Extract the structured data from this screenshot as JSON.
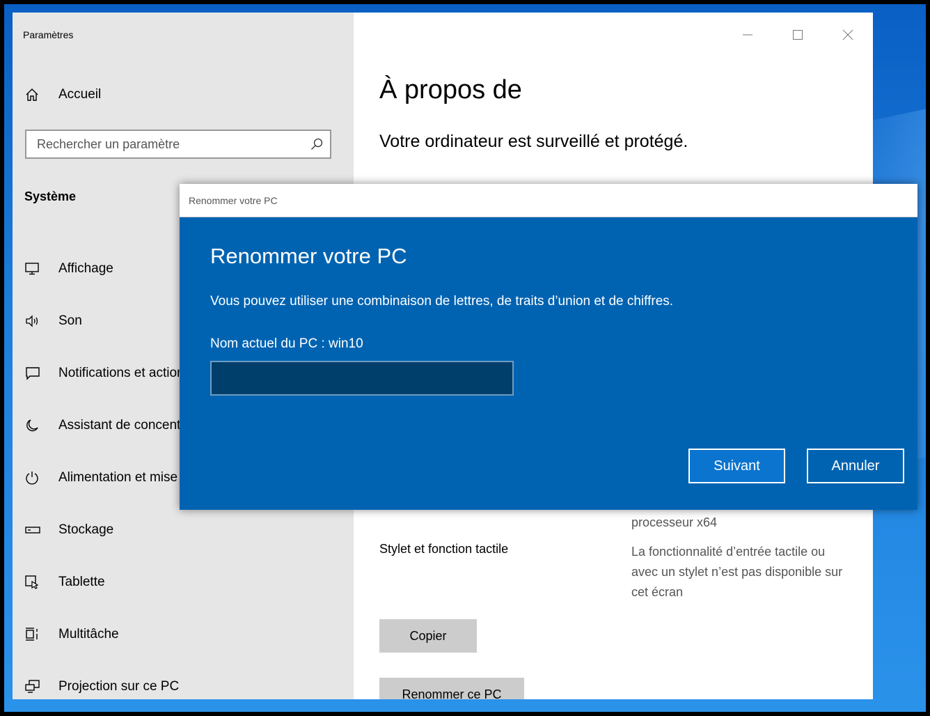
{
  "window": {
    "title": "Paramètres"
  },
  "sidebar": {
    "home_label": "Accueil",
    "search_placeholder": "Rechercher un paramètre",
    "section_title": "Système",
    "items": [
      {
        "label": "Affichage",
        "icon": "monitor-icon"
      },
      {
        "label": "Son",
        "icon": "speaker-icon"
      },
      {
        "label": "Notifications et actions",
        "icon": "notification-icon"
      },
      {
        "label": "Assistant de concentration",
        "icon": "moon-icon"
      },
      {
        "label": "Alimentation et mise en veille",
        "icon": "power-icon"
      },
      {
        "label": "Stockage",
        "icon": "storage-icon"
      },
      {
        "label": "Tablette",
        "icon": "tablet-icon"
      },
      {
        "label": "Multitâche",
        "icon": "multitask-icon"
      },
      {
        "label": "Projection sur ce PC",
        "icon": "projection-icon"
      }
    ]
  },
  "main": {
    "title": "À propos de",
    "status": "Votre ordinateur est surveillé et protégé.",
    "processor_text": "processeur x64",
    "pen_touch": {
      "label": "Stylet et fonction tactile",
      "value": "La fonctionnalité d’entrée tactile ou avec un stylet n’est pas disponible sur cet écran"
    },
    "copy_button": "Copier",
    "rename_button": "Renommer ce PC"
  },
  "dialog": {
    "window_title": "Renommer votre PC",
    "heading": "Renommer votre PC",
    "description": "Vous pouvez utiliser une combinaison de lettres, de traits d’union et de chiffres.",
    "current_name_label": "Nom actuel du PC : win10",
    "input_value": "",
    "next_button": "Suivant",
    "cancel_button": "Annuler"
  },
  "colors": {
    "dialog_bg": "#0063b1",
    "sidebar_bg": "#e6e6e6",
    "input_bg": "#003e6b"
  }
}
